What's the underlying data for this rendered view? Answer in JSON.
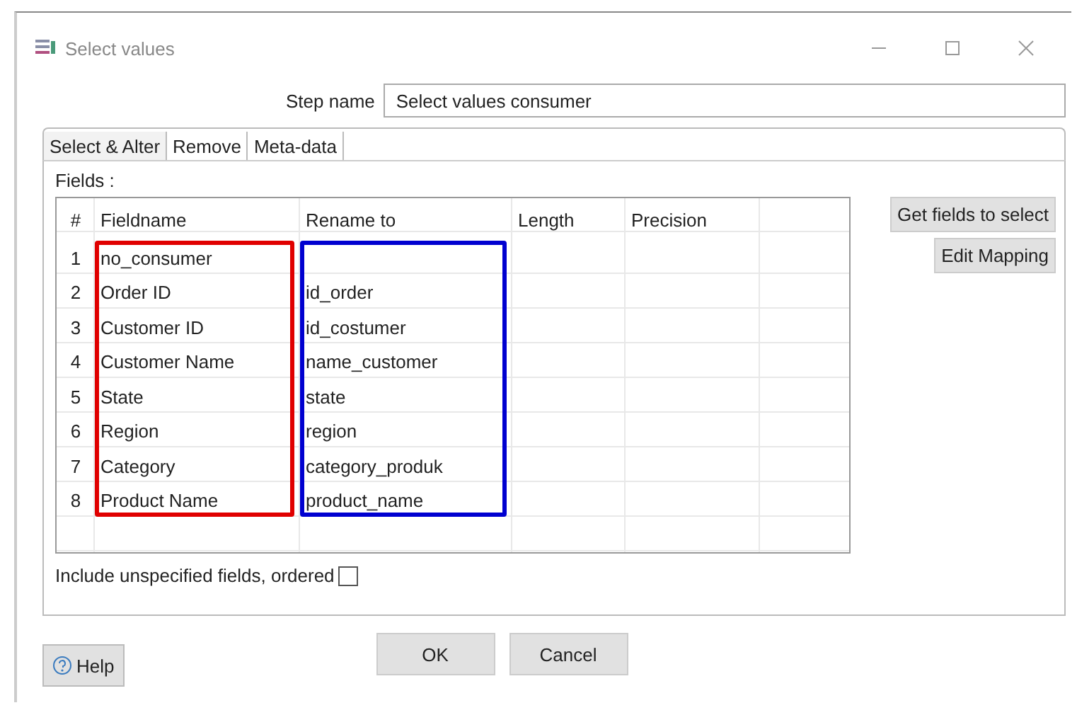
{
  "window": {
    "title": "Select values"
  },
  "step_name": {
    "label": "Step name",
    "value": "Select values consumer"
  },
  "tabs": [
    {
      "label": "Select & Alter",
      "selected": true
    },
    {
      "label": "Remove",
      "selected": false
    },
    {
      "label": "Meta-data",
      "selected": false
    }
  ],
  "fields_label": "Fields :",
  "table": {
    "columns": [
      {
        "label": "#"
      },
      {
        "label": "Fieldname",
        "color": "#e00000"
      },
      {
        "label": "Rename to",
        "color": "#0000d0"
      },
      {
        "label": "Length"
      },
      {
        "label": "Precision"
      }
    ],
    "rows": [
      {
        "number": "1",
        "fieldname": "no_consumer"
      },
      {
        "number": "2",
        "fieldname": "Order ID",
        "rename_to": "id_order"
      },
      {
        "number": "3",
        "fieldname": "Customer ID",
        "rename_to": "id_costumer"
      },
      {
        "number": "4",
        "fieldname": "Customer Name",
        "rename_to": "name_customer"
      },
      {
        "number": "5",
        "fieldname": "State",
        "rename_to": "state"
      },
      {
        "number": "6",
        "fieldname": "Region",
        "rename_to": "region"
      },
      {
        "number": "7",
        "fieldname": "Category",
        "rename_to": "category_produk"
      },
      {
        "number": "8",
        "fieldname": "Product Name",
        "rename_to": "product_name"
      }
    ]
  },
  "side_buttons": [
    "Get fields to select",
    "Edit Mapping"
  ],
  "include_unspecified": {
    "label": "Include unspecified fields, ordered",
    "checked": false
  },
  "buttons": [
    "OK",
    "Cancel"
  ],
  "help_button": "Help"
}
